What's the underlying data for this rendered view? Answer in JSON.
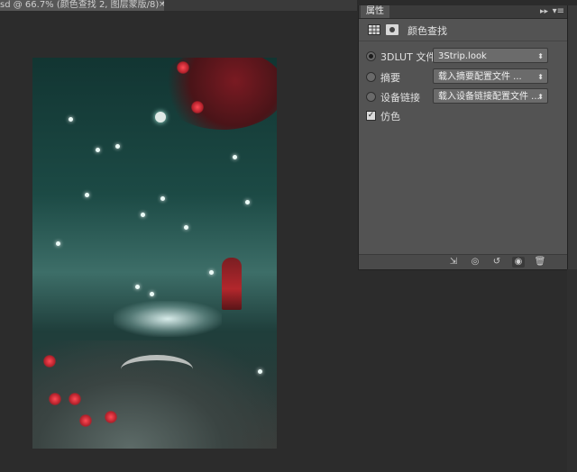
{
  "document": {
    "tab_title": "sd @ 66.7% (颜色查找 2, 图层蒙版/8) *",
    "close_symbol": "×"
  },
  "panel": {
    "tab_label": "属性",
    "collapse_symbol": "▸▸",
    "menu_symbol": "▾≡",
    "title": "颜色查找",
    "rows": [
      {
        "label": "3DLUT 文件",
        "value": "3Strip.look",
        "selected": true
      },
      {
        "label": "摘要",
        "value": "载入摘要配置文件 ...",
        "selected": false
      },
      {
        "label": "设备链接",
        "value": "载入设备链接配置文件 ...",
        "selected": false
      }
    ],
    "dither": {
      "label": "仿色",
      "checked": true,
      "check_symbol": "✓"
    },
    "footer_icons": [
      "clip-to-layer-icon",
      "view-previous-icon",
      "reset-icon",
      "visibility-icon",
      "delete-icon"
    ],
    "footer_glyphs": [
      "⇲",
      "◎",
      "↺",
      "◉",
      "🗑"
    ],
    "select_arrow": "⬍"
  },
  "colors": {
    "app_bg": "#2c2c2c",
    "panel_bg": "#535353",
    "accent_red": "#b2272c",
    "canvas_teal": "#1c4a45"
  }
}
